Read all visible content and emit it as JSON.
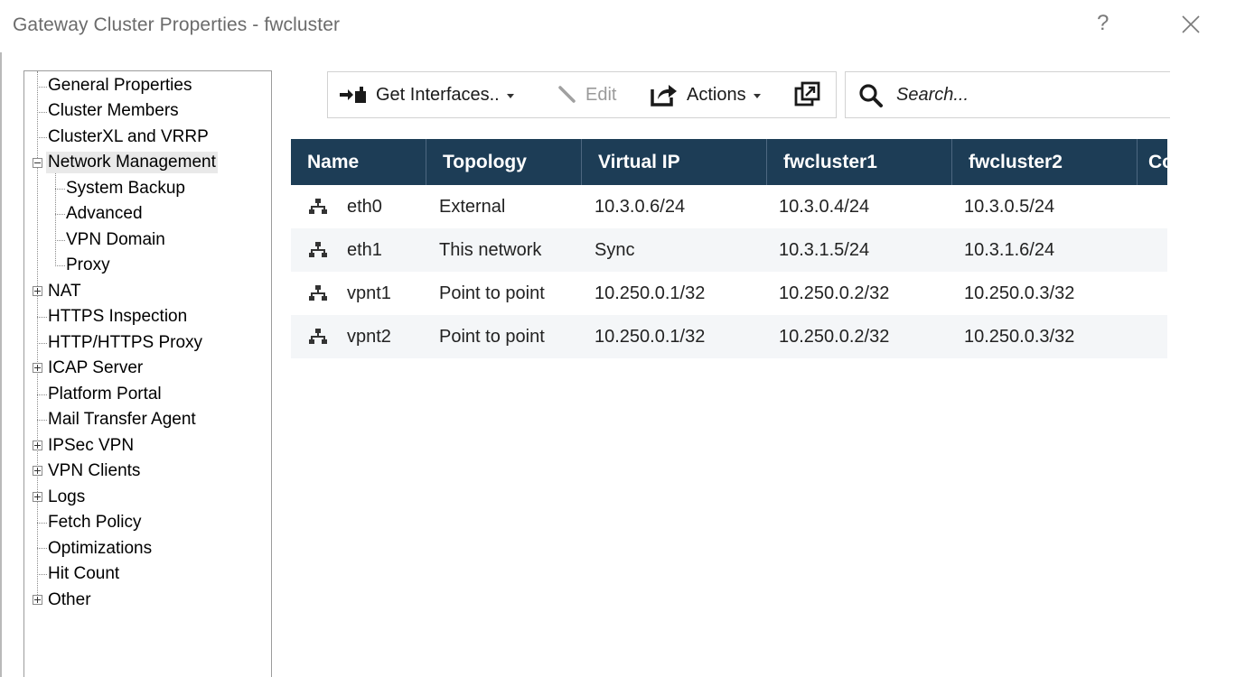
{
  "window": {
    "title": "Gateway Cluster Properties - fwcluster",
    "help_label": "?",
    "close_icon": "close-icon"
  },
  "tree": {
    "items": [
      {
        "label": "General Properties"
      },
      {
        "label": "Cluster Members"
      },
      {
        "label": "ClusterXL and VRRP"
      },
      {
        "label": "Network Management",
        "expanded": true,
        "selected": true
      },
      {
        "label": "System Backup"
      },
      {
        "label": "Advanced"
      },
      {
        "label": "VPN Domain"
      },
      {
        "label": "Proxy"
      },
      {
        "label": "NAT",
        "expandable": true
      },
      {
        "label": "HTTPS Inspection"
      },
      {
        "label": "HTTP/HTTPS Proxy"
      },
      {
        "label": "ICAP Server",
        "expandable": true
      },
      {
        "label": "Platform Portal"
      },
      {
        "label": "Mail Transfer Agent"
      },
      {
        "label": "IPSec VPN",
        "expandable": true
      },
      {
        "label": "VPN Clients",
        "expandable": true
      },
      {
        "label": "Logs",
        "expandable": true
      },
      {
        "label": "Fetch Policy"
      },
      {
        "label": "Optimizations"
      },
      {
        "label": "Hit Count"
      },
      {
        "label": "Other",
        "expandable": true
      }
    ]
  },
  "toolbar": {
    "get_interfaces_label": "Get Interfaces..",
    "edit_label": "Edit",
    "actions_label": "Actions",
    "icons": [
      "get-interfaces-icon",
      "edit-pencil-icon",
      "actions-export-icon",
      "open-in-window-icon"
    ]
  },
  "search": {
    "placeholder": "Search..."
  },
  "table": {
    "columns": [
      "Name",
      "Topology",
      "Virtual IP",
      "fwcluster1",
      "fwcluster2",
      "Co"
    ],
    "rows": [
      {
        "name": "eth0",
        "topology": "External",
        "virtual_ip": "10.3.0.6/24",
        "fwcluster1": "10.3.0.4/24",
        "fwcluster2": "10.3.0.5/24"
      },
      {
        "name": "eth1",
        "topology": "This network",
        "virtual_ip": "Sync",
        "fwcluster1": "10.3.1.5/24",
        "fwcluster2": "10.3.1.6/24"
      },
      {
        "name": "vpnt1",
        "topology": "Point to point",
        "virtual_ip": "10.250.0.1/32",
        "fwcluster1": "10.250.0.2/32",
        "fwcluster2": "10.250.0.3/32"
      },
      {
        "name": "vpnt2",
        "topology": "Point to point",
        "virtual_ip": "10.250.0.1/32",
        "fwcluster1": "10.250.0.2/32",
        "fwcluster2": "10.250.0.3/32"
      }
    ]
  },
  "colors": {
    "header_bg": "#1d3d56",
    "accent_icon": "#1f7fc4",
    "selection": "#e9e9e9"
  }
}
